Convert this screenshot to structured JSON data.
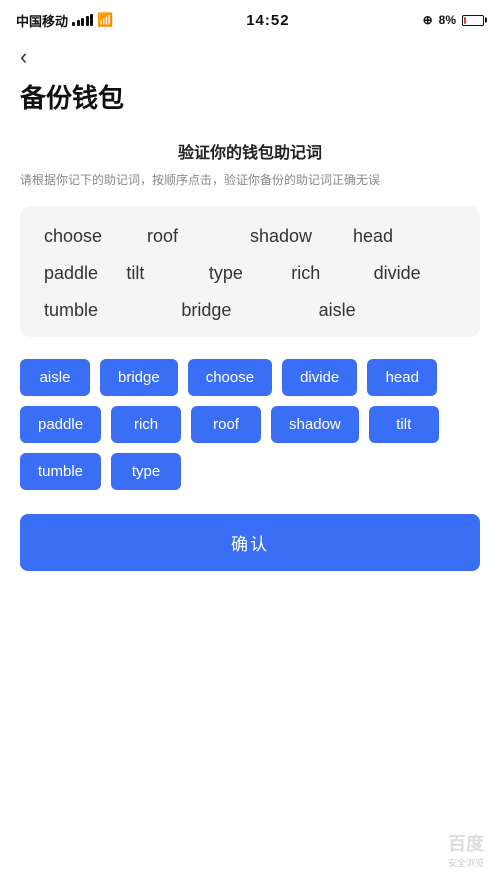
{
  "statusBar": {
    "carrier": "中国移动",
    "time": "14:52",
    "batteryPercent": "8%"
  },
  "backBtn": {
    "label": "‹"
  },
  "pageTitle": "备份钱包",
  "sectionTitle": "验证你的钱包助记词",
  "sectionSubtitle": "请根据你记下的助记词，按顺序点击，验证你备份的助记词正确无误",
  "wordGridRows": [
    [
      "choose",
      "roof",
      "shadow",
      "head"
    ],
    [
      "paddle",
      "tilt",
      "type",
      "rich",
      "divide"
    ],
    [
      "tumble",
      "bridge",
      "aisle"
    ]
  ],
  "chips": [
    "aisle",
    "bridge",
    "choose",
    "divide",
    "head",
    "paddle",
    "rich",
    "roof",
    "shadow",
    "tilt",
    "tumble",
    "type"
  ],
  "confirmBtn": "确认"
}
